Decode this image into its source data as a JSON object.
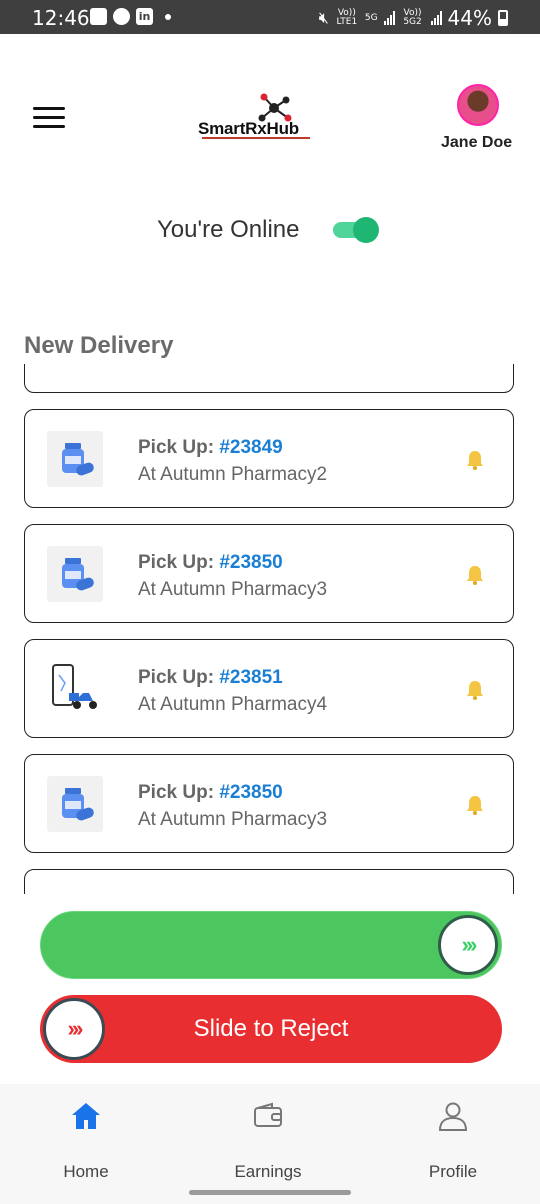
{
  "status_bar": {
    "time": "12:46",
    "network_labels": [
      "Vo)) LTE1",
      "5G",
      "Vo)) 5G2"
    ],
    "battery": "44%"
  },
  "header": {
    "logo_text": "SmartRxHub",
    "user_name": "Jane Doe"
  },
  "status": {
    "online_label": "You're Online",
    "online": true
  },
  "section": {
    "title": "New Delivery"
  },
  "deliveries": [
    {
      "prefix": "Pick Up: ",
      "order": "#23849",
      "location": "At Autumn Pharmacy2",
      "thumb": "medicine-bottle-icon"
    },
    {
      "prefix": "Pick Up: ",
      "order": "#23850",
      "location": "At Autumn Pharmacy3",
      "thumb": "medicine-bottle-icon"
    },
    {
      "prefix": "Pick Up: ",
      "order": "#23851",
      "location": "At Autumn Pharmacy4",
      "thumb": "delivery-scooter-icon"
    },
    {
      "prefix": "Pick Up: ",
      "order": "#23850",
      "location": "At Autumn Pharmacy3",
      "thumb": "medicine-bottle-icon"
    }
  ],
  "actions": {
    "accept_handle": "›››",
    "reject_handle": "›››",
    "reject_label": "Slide to Reject"
  },
  "nav": {
    "home": "Home",
    "earnings": "Earnings",
    "profile": "Profile"
  },
  "colors": {
    "accent_blue": "#1a7fd4",
    "online_green": "#1fb572",
    "accept_green": "#4cc760",
    "reject_red": "#e82e30",
    "bell_yellow": "#f4c542"
  }
}
